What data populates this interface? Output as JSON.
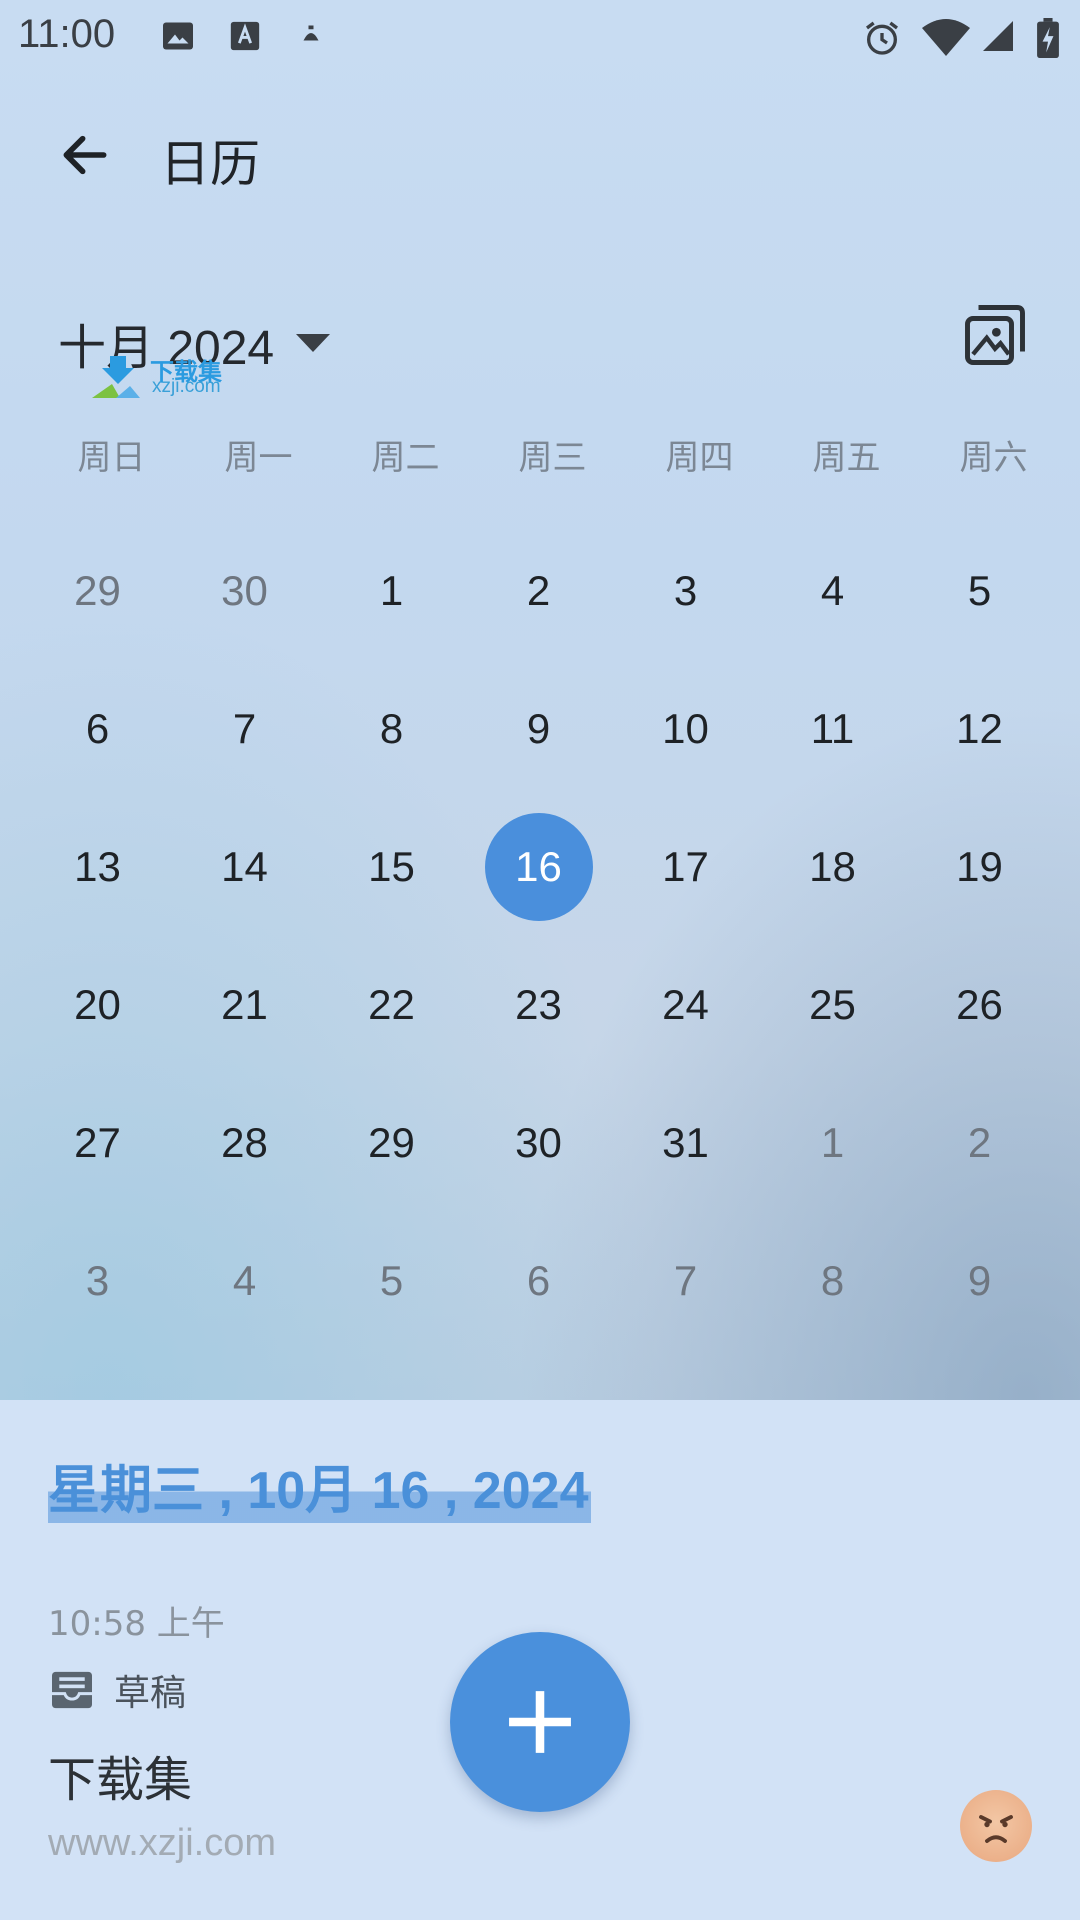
{
  "status_bar": {
    "time": "11:00",
    "left_icons": [
      "image-icon",
      "text-a-icon",
      "android-debug-icon"
    ],
    "right_icons": [
      "alarm-icon",
      "wifi-icon",
      "signal-icon",
      "battery-charging-icon"
    ]
  },
  "app_bar": {
    "title": "日历",
    "back_icon": "arrow-left-icon"
  },
  "calendar": {
    "month_label": "十月 2024",
    "weekdays": [
      "周日",
      "周一",
      "周二",
      "周三",
      "周四",
      "周五",
      "周六"
    ],
    "weeks": [
      [
        {
          "d": "29",
          "other": true
        },
        {
          "d": "30",
          "other": true
        },
        {
          "d": "1"
        },
        {
          "d": "2"
        },
        {
          "d": "3"
        },
        {
          "d": "4"
        },
        {
          "d": "5"
        }
      ],
      [
        {
          "d": "6"
        },
        {
          "d": "7"
        },
        {
          "d": "8"
        },
        {
          "d": "9"
        },
        {
          "d": "10"
        },
        {
          "d": "11"
        },
        {
          "d": "12"
        }
      ],
      [
        {
          "d": "13"
        },
        {
          "d": "14"
        },
        {
          "d": "15"
        },
        {
          "d": "16",
          "selected": true
        },
        {
          "d": "17"
        },
        {
          "d": "18"
        },
        {
          "d": "19"
        }
      ],
      [
        {
          "d": "20"
        },
        {
          "d": "21"
        },
        {
          "d": "22"
        },
        {
          "d": "23"
        },
        {
          "d": "24"
        },
        {
          "d": "25"
        },
        {
          "d": "26"
        }
      ],
      [
        {
          "d": "27"
        },
        {
          "d": "28"
        },
        {
          "d": "29"
        },
        {
          "d": "30"
        },
        {
          "d": "31"
        },
        {
          "d": "1",
          "other": true
        },
        {
          "d": "2",
          "other": true
        }
      ],
      [
        {
          "d": "3",
          "other": true
        },
        {
          "d": "4",
          "other": true
        },
        {
          "d": "5",
          "other": true
        },
        {
          "d": "6",
          "other": true
        },
        {
          "d": "7",
          "other": true
        },
        {
          "d": "8",
          "other": true
        },
        {
          "d": "9",
          "other": true
        }
      ]
    ],
    "selected_color": "#4a8fdc"
  },
  "watermark": {
    "text_cn": "下载集",
    "text_url": "xzji.com"
  },
  "details": {
    "selected_date": "星期三 , 10月 16 , 2024",
    "note_time": "10:58 上午",
    "draft_label": "草稿",
    "note_title": "下载集",
    "note_url": "www.xzji.com"
  },
  "colors": {
    "accent": "#4a90dc",
    "panel_bg": "#d2e2f6"
  }
}
